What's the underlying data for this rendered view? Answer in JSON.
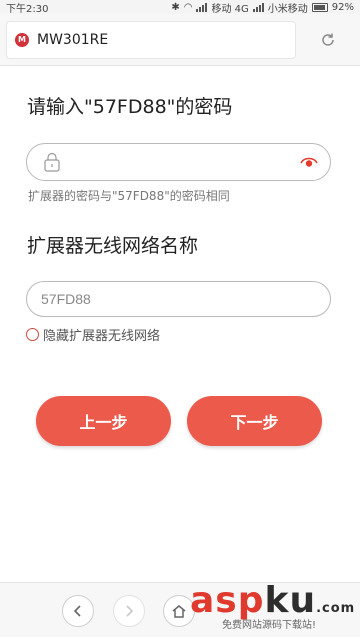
{
  "status_bar": {
    "time": "下午2:30",
    "network": "移动 4G",
    "carrier2": "小米移动",
    "battery": "92%"
  },
  "browser": {
    "url_title": "MW301RE",
    "site_icon_text": "M",
    "refresh_icon": "refresh-icon"
  },
  "page": {
    "title": "请输入\"57FD88\"的密码",
    "password_value": "",
    "password_hint": "扩展器的密码与\"57FD88\"的密码相同",
    "section_title": "扩展器无线网络名称",
    "ssid_value": "57FD88",
    "hide_label": "隐藏扩展器无线网络",
    "prev_label": "上一步",
    "next_label": "下一步"
  },
  "nav": {
    "back_icon": "chevron-left-icon",
    "forward_icon": "chevron-right-icon",
    "home_icon": "home-icon"
  },
  "watermark": {
    "asp": "asp",
    "ku": "ku",
    "domain": ".com",
    "subtitle": "免费网站源码下载站!"
  },
  "colors": {
    "accent": "#ec5a4c",
    "radio": "#d2473b"
  }
}
